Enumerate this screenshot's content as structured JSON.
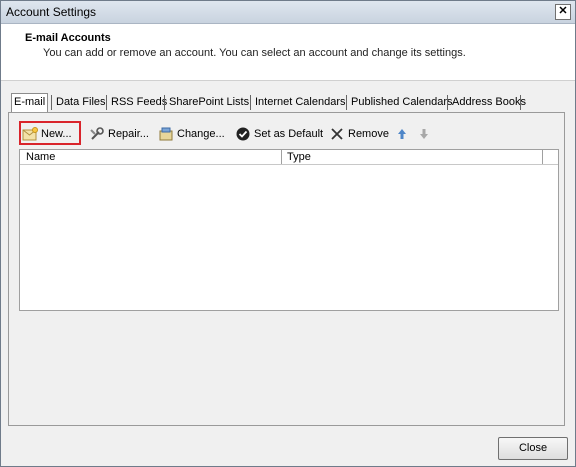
{
  "window": {
    "title": "Account Settings"
  },
  "header": {
    "title": "E-mail Accounts",
    "subtitle": "You can add or remove an account. You can select an account and change its settings."
  },
  "tabs": [
    {
      "label": "E-mail",
      "active": true
    },
    {
      "label": "Data Files"
    },
    {
      "label": "RSS Feeds"
    },
    {
      "label": "SharePoint Lists"
    },
    {
      "label": "Internet Calendars"
    },
    {
      "label": "Published Calendars"
    },
    {
      "label": "Address Books"
    }
  ],
  "toolbar": {
    "new_label": "New...",
    "repair_label": "Repair...",
    "change_label": "Change...",
    "default_label": "Set as Default",
    "remove_label": "Remove"
  },
  "list": {
    "columns": [
      "Name",
      "Type"
    ]
  },
  "footer": {
    "close_label": "Close"
  },
  "colors": {
    "highlight": "#d9242b"
  }
}
